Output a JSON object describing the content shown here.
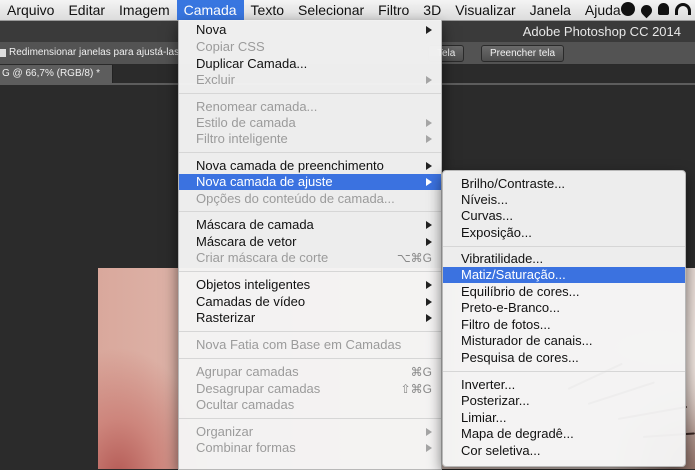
{
  "menubar": {
    "items": [
      "Arquivo",
      "Editar",
      "Imagem",
      "Camada",
      "Texto",
      "Selecionar",
      "Filtro",
      "3D",
      "Visualizar",
      "Janela",
      "Ajuda"
    ],
    "active_index": 3,
    "status_icons": [
      "app-round-icon",
      "drop-icon",
      "bell-icon",
      "wifi-icon"
    ]
  },
  "app": {
    "title": "Adobe Photoshop CC 2014"
  },
  "options_bar": {
    "checkbox_label": "Redimensionar janelas para ajustá-las",
    "partial_button": "Tela",
    "fill_button": "Preencher tela"
  },
  "document": {
    "tab_label": "G @ 66,7% (RGB/8) *"
  },
  "layer_menu": {
    "items": [
      {
        "label": "Nova",
        "arrow": true,
        "disabled": false
      },
      {
        "label": "Copiar CSS",
        "disabled": true
      },
      {
        "label": "Duplicar Camada...",
        "disabled": false
      },
      {
        "label": "Excluir",
        "arrow": true,
        "disabled": true
      },
      {
        "label": "Renomear camada...",
        "disabled": true
      },
      {
        "label": "Estilo de camada",
        "arrow": true,
        "disabled": true
      },
      {
        "label": "Filtro inteligente",
        "arrow": true,
        "disabled": true
      },
      {
        "label": "Nova camada de preenchimento",
        "arrow": true,
        "disabled": false
      },
      {
        "label": "Nova camada de ajuste",
        "arrow": true,
        "disabled": false,
        "highlight": true
      },
      {
        "label": "Opções do conteúdo de camada...",
        "disabled": true
      },
      {
        "label": "Máscara de camada",
        "arrow": true,
        "disabled": false
      },
      {
        "label": "Máscara de vetor",
        "arrow": true,
        "disabled": false
      },
      {
        "label": "Criar máscara de corte",
        "shortcut": "⌥⌘G",
        "disabled": true
      },
      {
        "label": "Objetos inteligentes",
        "arrow": true,
        "disabled": false
      },
      {
        "label": "Camadas de vídeo",
        "arrow": true,
        "disabled": false
      },
      {
        "label": "Rasterizar",
        "arrow": true,
        "disabled": false
      },
      {
        "label": "Nova Fatia com Base em Camadas",
        "disabled": true
      },
      {
        "label": "Agrupar camadas",
        "shortcut": "⌘G",
        "disabled": true
      },
      {
        "label": "Desagrupar camadas",
        "shortcut": "⇧⌘G",
        "disabled": true
      },
      {
        "label": "Ocultar camadas",
        "disabled": true
      },
      {
        "label": "Organizar",
        "arrow": true,
        "disabled": true
      },
      {
        "label": "Combinar formas",
        "arrow": true,
        "disabled": true
      }
    ]
  },
  "adjustment_submenu": {
    "items": [
      {
        "label": "Brilho/Contraste..."
      },
      {
        "label": "Níveis..."
      },
      {
        "label": "Curvas..."
      },
      {
        "label": "Exposição..."
      },
      {
        "label": "Vibratilidade..."
      },
      {
        "label": "Matiz/Saturação...",
        "highlight": true
      },
      {
        "label": "Equilíbrio de cores..."
      },
      {
        "label": "Preto-e-Branco..."
      },
      {
        "label": "Filtro de fotos..."
      },
      {
        "label": "Misturador de canais..."
      },
      {
        "label": "Pesquisa de cores..."
      },
      {
        "label": "Inverter..."
      },
      {
        "label": "Posterizar..."
      },
      {
        "label": "Limiar..."
      },
      {
        "label": "Mapa de degradê..."
      },
      {
        "label": "Cor seletiva..."
      }
    ]
  },
  "colors": {
    "highlight": "#3b72e0",
    "disabled_text": "#9b9b9b"
  }
}
